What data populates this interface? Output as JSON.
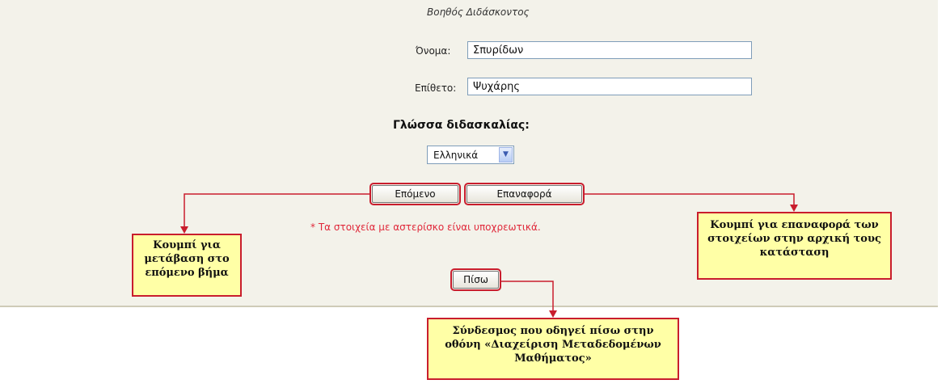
{
  "form": {
    "subtitle": "Βοηθός Διδάσκοντος",
    "first_name_label": "Όνομα:",
    "first_name_value": "Σπυρίδων",
    "last_name_label": "Επίθετο:",
    "last_name_value": "Ψυχάρης",
    "language_label": "Γλώσσα διδασκαλίας:",
    "language_selected": "Ελληνικά",
    "next_label": "Επόμενο",
    "reset_label": "Επαναφορά",
    "required_note": "* Τα στοιχεία με αστερίσκο είναι υποχρεωτικά.",
    "back_label": "Πίσω"
  },
  "callouts": {
    "next": "Κουμπί για μετάβαση στο επόμενο βήμα",
    "reset": "Κουμπί για επαναφορά των στοιχείων στην αρχική τους κατάσταση",
    "back": "Σύνδεσμος που οδηγεί πίσω στην οθόνη «Διαχείριση Μεταδεδομένων Μαθήματος»"
  },
  "colors": {
    "panel_bg": "#f3f2ea",
    "callout_bg": "#ffffa6",
    "callout_border": "#c91d2d",
    "required_text": "#e0283a"
  },
  "icons": {
    "select_arrow": "chevron-down-icon"
  }
}
